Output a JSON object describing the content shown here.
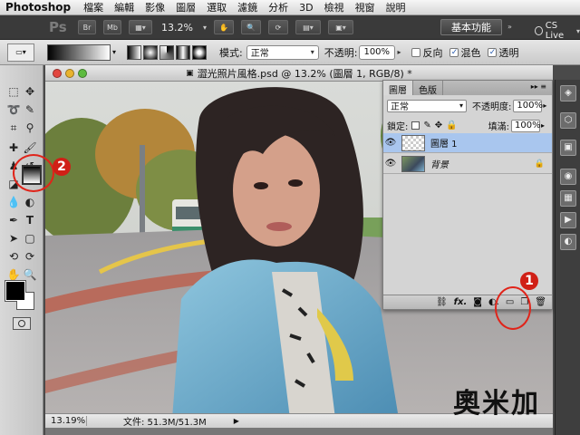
{
  "menubar": {
    "app_name": "Photoshop",
    "items": [
      "檔案",
      "編輯",
      "影像",
      "圖層",
      "選取",
      "濾鏡",
      "分析",
      "3D",
      "檢視",
      "視窗",
      "說明"
    ]
  },
  "appbar": {
    "logo": "Ps",
    "br_label": "Br",
    "mb_label": "Mb",
    "zoom": "13.2%",
    "workspace": "基本功能",
    "cs_live": "CS Live"
  },
  "options": {
    "mode_label": "模式:",
    "mode_value": "正常",
    "opacity_label": "不透明:",
    "opacity_value": "100%",
    "reverse_label": "反向",
    "dither_label": "混色",
    "transparency_label": "透明"
  },
  "document": {
    "title": "澀光照片風格.psd @ 13.2% (圖層 1, RGB/8) *",
    "zoom": "13.19%",
    "file_info": "文件: 51.3M/51.3M"
  },
  "layers_panel": {
    "tab_layers": "圖層",
    "tab_channels": "色版",
    "blend_mode": "正常",
    "opacity_label": "不透明度:",
    "opacity_value": "100%",
    "lock_label": "鎖定:",
    "fill_label": "填滿:",
    "fill_value": "100%",
    "layers": [
      {
        "name": "圖層 1",
        "selected": true
      },
      {
        "name": "背景",
        "selected": false
      }
    ]
  },
  "annotations": {
    "step_one": "1",
    "step_two": "2"
  },
  "watermark": "奧米加"
}
